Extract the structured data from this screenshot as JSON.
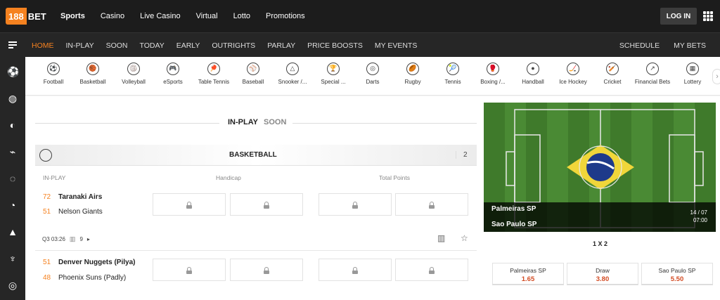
{
  "brand": {
    "logo_text": "188",
    "logo_suffix": "BET"
  },
  "top_nav": [
    "Sports",
    "Casino",
    "Live Casino",
    "Virtual",
    "Lotto",
    "Promotions"
  ],
  "login_label": "LOG IN",
  "sub_nav": [
    "HOME",
    "IN-PLAY",
    "SOON",
    "TODAY",
    "EARLY",
    "OUTRIGHTS",
    "PARLAY",
    "PRICE BOOSTS",
    "MY EVENTS"
  ],
  "sub_nav_right": [
    "SCHEDULE",
    "MY BETS"
  ],
  "sports": [
    "Football",
    "Basketball",
    "Volleyball",
    "eSports",
    "Table Tennis",
    "Baseball",
    "Snooker /...",
    "Special ...",
    "Darts",
    "Rugby",
    "Tennis",
    "Boxing /...",
    "Handball",
    "Ice Hockey",
    "Cricket",
    "Financial Bets",
    "Lottery"
  ],
  "sport_icons": [
    "⚽",
    "🏀",
    "🏐",
    "🎮",
    "🏓",
    "⚾",
    "△",
    "🏆",
    "◎",
    "🏉",
    "🎾",
    "🥊",
    "●",
    "🏒",
    "🏏",
    "↗",
    "▦"
  ],
  "toggle": {
    "active": "IN-PLAY",
    "inactive": "SOON"
  },
  "section": {
    "title": "BASKETBALL",
    "count": "2"
  },
  "columns": {
    "status": "IN-PLAY",
    "handicap": "Handicap",
    "total": "Total Points"
  },
  "matches": [
    {
      "score_home": "72",
      "home": "Taranaki Airs",
      "score_away": "51",
      "away": "Nelson Giants",
      "period": "Q3 03:26",
      "markets": "9"
    },
    {
      "score_home": "51",
      "home": "Denver Nuggets (Pilya)",
      "score_away": "48",
      "away": "Phoenix Suns (Padly)"
    }
  ],
  "featured": {
    "home": "Palmeiras SP",
    "away": "Sao Paulo SP",
    "date": "14 / 07",
    "time": "07:00",
    "market": "1 X 2",
    "odds": [
      {
        "name": "Palmeiras SP",
        "value": "1.65"
      },
      {
        "name": "Draw",
        "value": "3.80"
      },
      {
        "name": "Sao Paulo SP",
        "value": "5.50"
      }
    ]
  },
  "colors": {
    "accent": "#f58220",
    "odds": "#d34c24",
    "topbar": "#1c1c1c"
  }
}
